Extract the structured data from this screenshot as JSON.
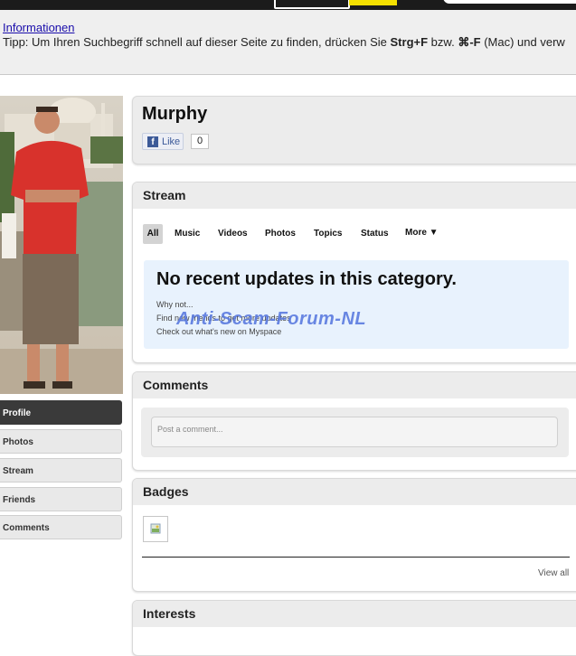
{
  "info_bar": {
    "link": "Informationen",
    "tip_prefix": "Tipp: Um Ihren Suchbegriff schnell auf dieser Seite zu finden, drücken Sie ",
    "tip_key1": "Strg+F",
    "tip_mid": " bzw. ",
    "tip_key2": "⌘-F",
    "tip_suffix": " (Mac) und verw"
  },
  "profile": {
    "name": "Murphy",
    "like_label": "Like",
    "like_count": "0"
  },
  "left_nav": {
    "items": [
      {
        "label": "Profile",
        "active": true
      },
      {
        "label": "Photos",
        "active": false
      },
      {
        "label": "Stream",
        "active": false
      },
      {
        "label": "Friends",
        "active": false
      },
      {
        "label": "Comments",
        "active": false
      }
    ]
  },
  "stream": {
    "title": "Stream",
    "tabs": [
      "All",
      "Music",
      "Videos",
      "Photos",
      "Topics",
      "Status",
      "More ▼"
    ],
    "empty_title": "No recent updates in this category.",
    "lines": [
      "Why not...",
      "Find new friends to get more updates",
      "Check out what's new on Myspace"
    ],
    "watermark": "Anti-Scam-Forum-NL"
  },
  "comments": {
    "title": "Comments",
    "placeholder": "Post a comment..."
  },
  "badges": {
    "title": "Badges",
    "view_all": "View all"
  },
  "interests": {
    "title": "Interests"
  },
  "colors": {
    "active_nav": "#3a3a3a",
    "link": "#1a0dab",
    "facebook": "#3b5998",
    "empty_box": "#e8f2fd",
    "watermark": "#5b7be0"
  }
}
